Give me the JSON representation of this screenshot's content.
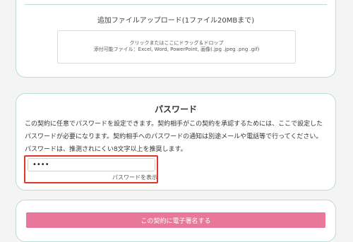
{
  "upload": {
    "title": "追加ファイルアップロード(1ファイル20MBまで)",
    "dropzone_line1": "クリックまたはここにドラッグ＆ドロップ",
    "dropzone_line2": "添付可能ファイル：Excel, Word, PowerPoint, 画像(.jpg .jpeg .png .gif)"
  },
  "password": {
    "title": "パスワード",
    "desc_line1": "この契約に任意でパスワードを設定できます。契約相手がこの契約を承認するためには、ここで設定した",
    "desc_line2": "パスワードが必要になります。契約相手へのパスワードの通知は別途メールや電話等で行ってください。",
    "desc_line3": "パスワードは、推測されにくい8文字以上を推奨します。",
    "input_value": "••••",
    "show_label": "パスワードを表示"
  },
  "sign": {
    "button_label": "この契約に電子署名する"
  },
  "colors": {
    "card_border": "#b9ddd9",
    "highlight": "#e0362c",
    "sign_button": "#e8789b"
  }
}
